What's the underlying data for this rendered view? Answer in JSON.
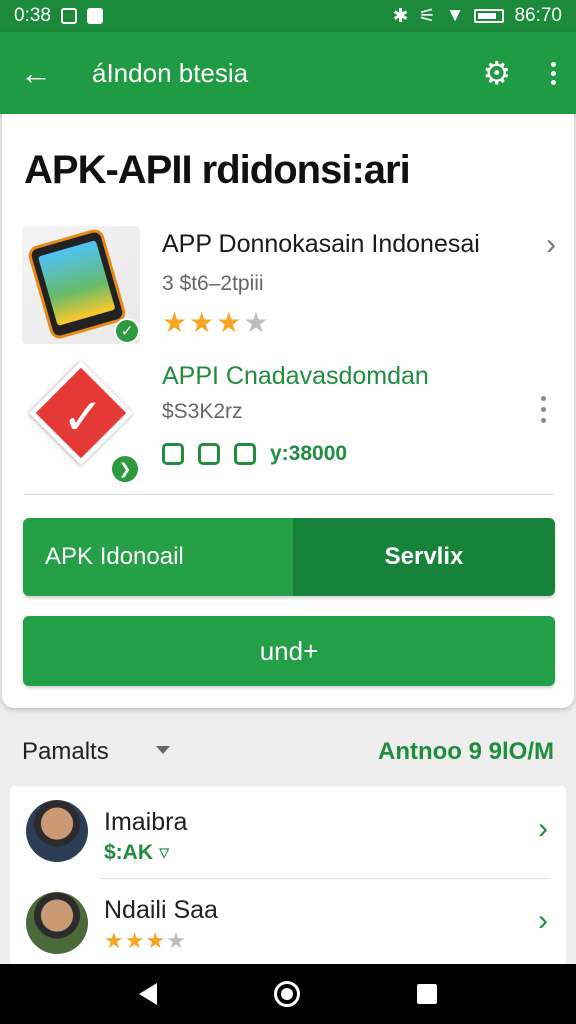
{
  "status_bar": {
    "time": "0:38",
    "battery_pct": "98%",
    "clock_right": "86:70"
  },
  "app_bar": {
    "title": "áIndon btesia",
    "back_icon": "arrow-left-icon",
    "settings_icon": "gear-icon",
    "menu_icon": "more-vert-icon"
  },
  "main": {
    "headline": "APK-APII rdidonsi:ari",
    "apps": [
      {
        "title": "APP Donnokasain Indonesai",
        "meta": "3 $t6–2tpiii",
        "rating": 3,
        "rating_max": 4
      },
      {
        "title": "APPI Cnadavasdomdan",
        "meta": "$S3K2rz",
        "stats": "y:38000"
      }
    ],
    "split_button": {
      "left_label": "APK Idonoail",
      "right_label": "Servlix"
    },
    "primary_button": {
      "label": "und+"
    }
  },
  "section": {
    "label": "Pamalts",
    "value": "Antnoo 9 9lO/M"
  },
  "people": [
    {
      "name": "Imaibra",
      "meta": "$:AK"
    },
    {
      "name": "Ndaili Saa",
      "rating": 3.5,
      "rating_max": 4
    }
  ],
  "colors": {
    "primary": "#1f9c43",
    "primary_dark": "#17833a",
    "status_bar": "#1b8a3a",
    "accent_star": "#f5a623"
  }
}
